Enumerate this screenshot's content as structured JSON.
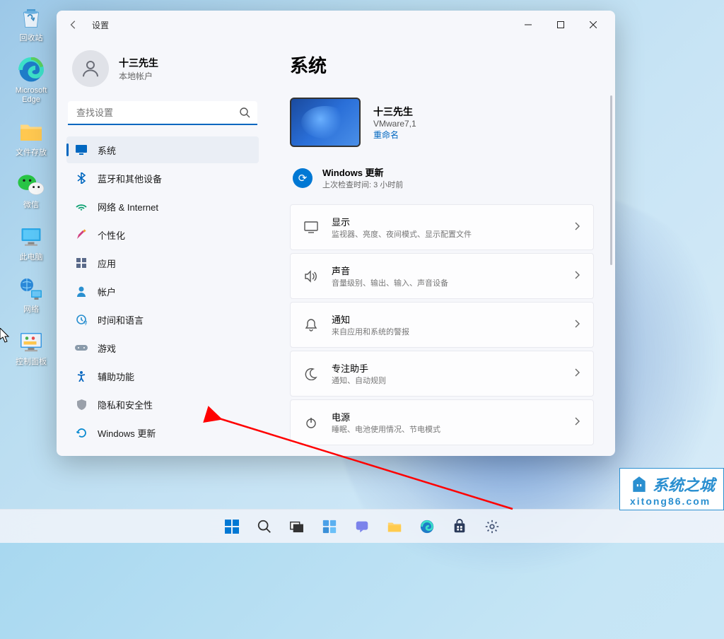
{
  "desktop": {
    "icons": [
      {
        "id": "recycle-bin",
        "label": "回收站",
        "glyph": "🗑️",
        "color": "#2b8cd8"
      },
      {
        "id": "edge",
        "label": "Microsoft Edge",
        "glyph": "🌐",
        "color": "#1e7cc8"
      },
      {
        "id": "folder",
        "label": "文件存放",
        "glyph": "📁",
        "color": "#ffd36e"
      },
      {
        "id": "wechat",
        "label": "微信",
        "glyph": "💬",
        "color": "#28c445"
      },
      {
        "id": "this-pc",
        "label": "此电脑",
        "glyph": "🖥️",
        "color": "#2aa8e8"
      },
      {
        "id": "network",
        "label": "网络",
        "glyph": "🌐",
        "color": "#2a88d8"
      },
      {
        "id": "control-panel",
        "label": "控制面板",
        "glyph": "⚙️",
        "color": "#3a9ce8"
      }
    ]
  },
  "window": {
    "title": "设置",
    "user": {
      "name": "十三先生",
      "type": "本地帐户"
    },
    "search": {
      "placeholder": "查找设置"
    },
    "nav": [
      {
        "id": "system",
        "label": "系统",
        "icon": "🖥️",
        "active": true
      },
      {
        "id": "bluetooth",
        "label": "蓝牙和其他设备",
        "icon": "ᛒ"
      },
      {
        "id": "network",
        "label": "网络 & Internet",
        "icon": "📶"
      },
      {
        "id": "personalization",
        "label": "个性化",
        "icon": "🖌️"
      },
      {
        "id": "apps",
        "label": "应用",
        "icon": "▦"
      },
      {
        "id": "accounts",
        "label": "帐户",
        "icon": "👤"
      },
      {
        "id": "time",
        "label": "时间和语言",
        "icon": "🕒"
      },
      {
        "id": "gaming",
        "label": "游戏",
        "icon": "🎮"
      },
      {
        "id": "accessibility",
        "label": "辅助功能",
        "icon": "✦"
      },
      {
        "id": "privacy",
        "label": "隐私和安全性",
        "icon": "🛡️"
      },
      {
        "id": "update",
        "label": "Windows 更新",
        "icon": "🔄"
      }
    ],
    "content": {
      "heading": "系统",
      "device": {
        "name": "十三先生",
        "model": "VMware7,1",
        "rename": "重命名"
      },
      "update": {
        "title": "Windows 更新",
        "sub": "上次检查时间: 3 小时前"
      },
      "items": [
        {
          "id": "display",
          "title": "显示",
          "sub": "监视器、亮度、夜间模式、显示配置文件",
          "icon": "▭"
        },
        {
          "id": "sound",
          "title": "声音",
          "sub": "音量级别、输出、输入、声音设备",
          "icon": "🔊"
        },
        {
          "id": "notifications",
          "title": "通知",
          "sub": "来自应用和系统的警报",
          "icon": "🔔"
        },
        {
          "id": "focus",
          "title": "专注助手",
          "sub": "通知、自动规则",
          "icon": "☽"
        },
        {
          "id": "power",
          "title": "电源",
          "sub": "睡眠、电池使用情况、节电模式",
          "icon": "⏻"
        }
      ]
    }
  },
  "watermark": {
    "brand": "系统之城",
    "url": "xitong86.com"
  }
}
